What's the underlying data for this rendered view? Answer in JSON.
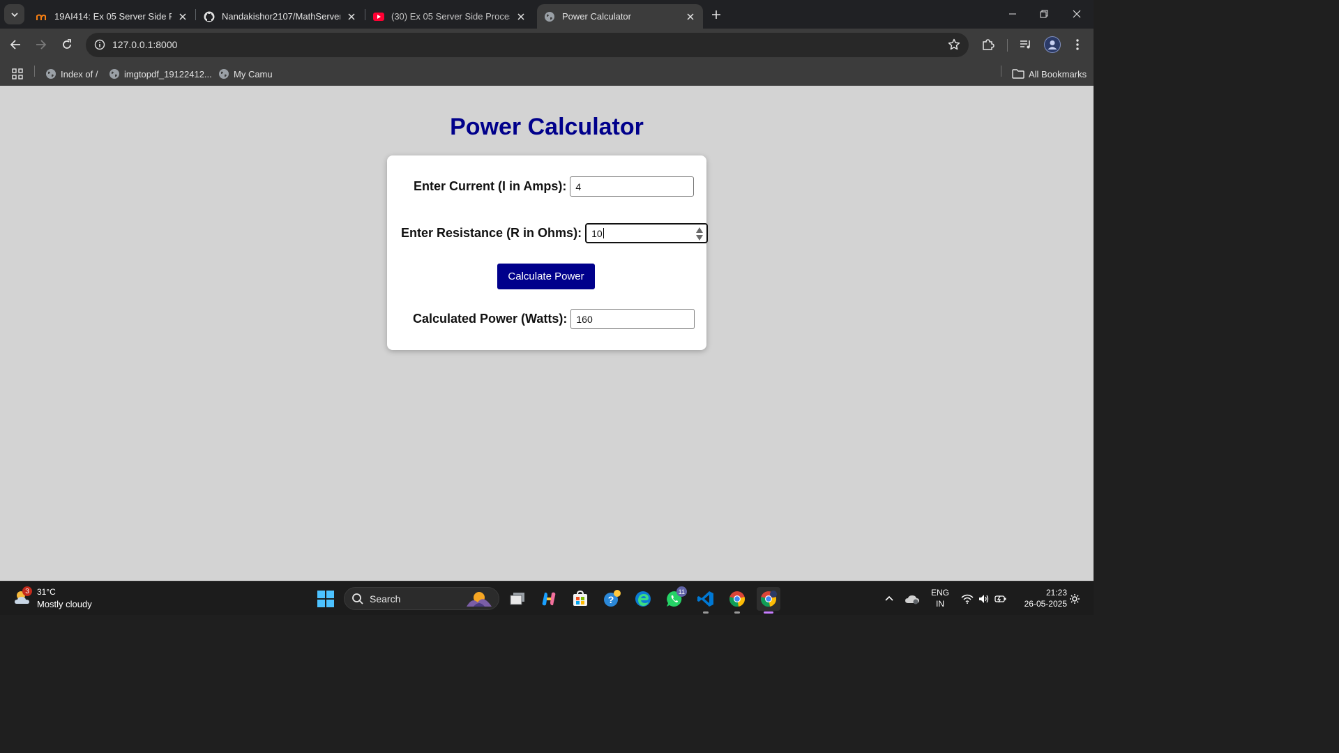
{
  "browser": {
    "tabs": [
      {
        "title": "19AI414: Ex 05 Server Side Proc",
        "favicon": "moodle-icon",
        "active": false
      },
      {
        "title": "Nandakishor2107/MathServer",
        "favicon": "github-icon",
        "active": false
      },
      {
        "title": "(30) Ex 05 Server Side Processin",
        "favicon": "youtube-icon",
        "active": false
      },
      {
        "title": "Power Calculator",
        "favicon": "globe-icon",
        "active": true
      }
    ],
    "url": "127.0.0.1:8000",
    "bookmarks": [
      {
        "label": "Index of /",
        "icon": "globe-icon"
      },
      {
        "label": "imgtopdf_19122412...",
        "icon": "globe-icon"
      },
      {
        "label": "My Camu",
        "icon": "globe-icon"
      }
    ],
    "all_bookmarks_label": "All Bookmarks"
  },
  "page": {
    "title": "Power Calculator",
    "current_label": "Enter Current (I in Amps):",
    "current_value": "4",
    "resistance_label": "Enter Resistance (R in Ohms):",
    "resistance_value": "10",
    "button_label": "Calculate Power",
    "result_label": "Calculated Power (Watts):",
    "result_value": "160"
  },
  "taskbar": {
    "weather": {
      "temp": "31°C",
      "desc": "Mostly cloudy",
      "badge": "3"
    },
    "search_label": "Search",
    "whatsapp_badge": "11",
    "language": "ENG",
    "region": "IN",
    "time": "21:23",
    "date": "26-05-2025"
  },
  "colors": {
    "page_background": "#d3d3d3",
    "title_color": "#00008b",
    "button_color": "#00008b"
  }
}
